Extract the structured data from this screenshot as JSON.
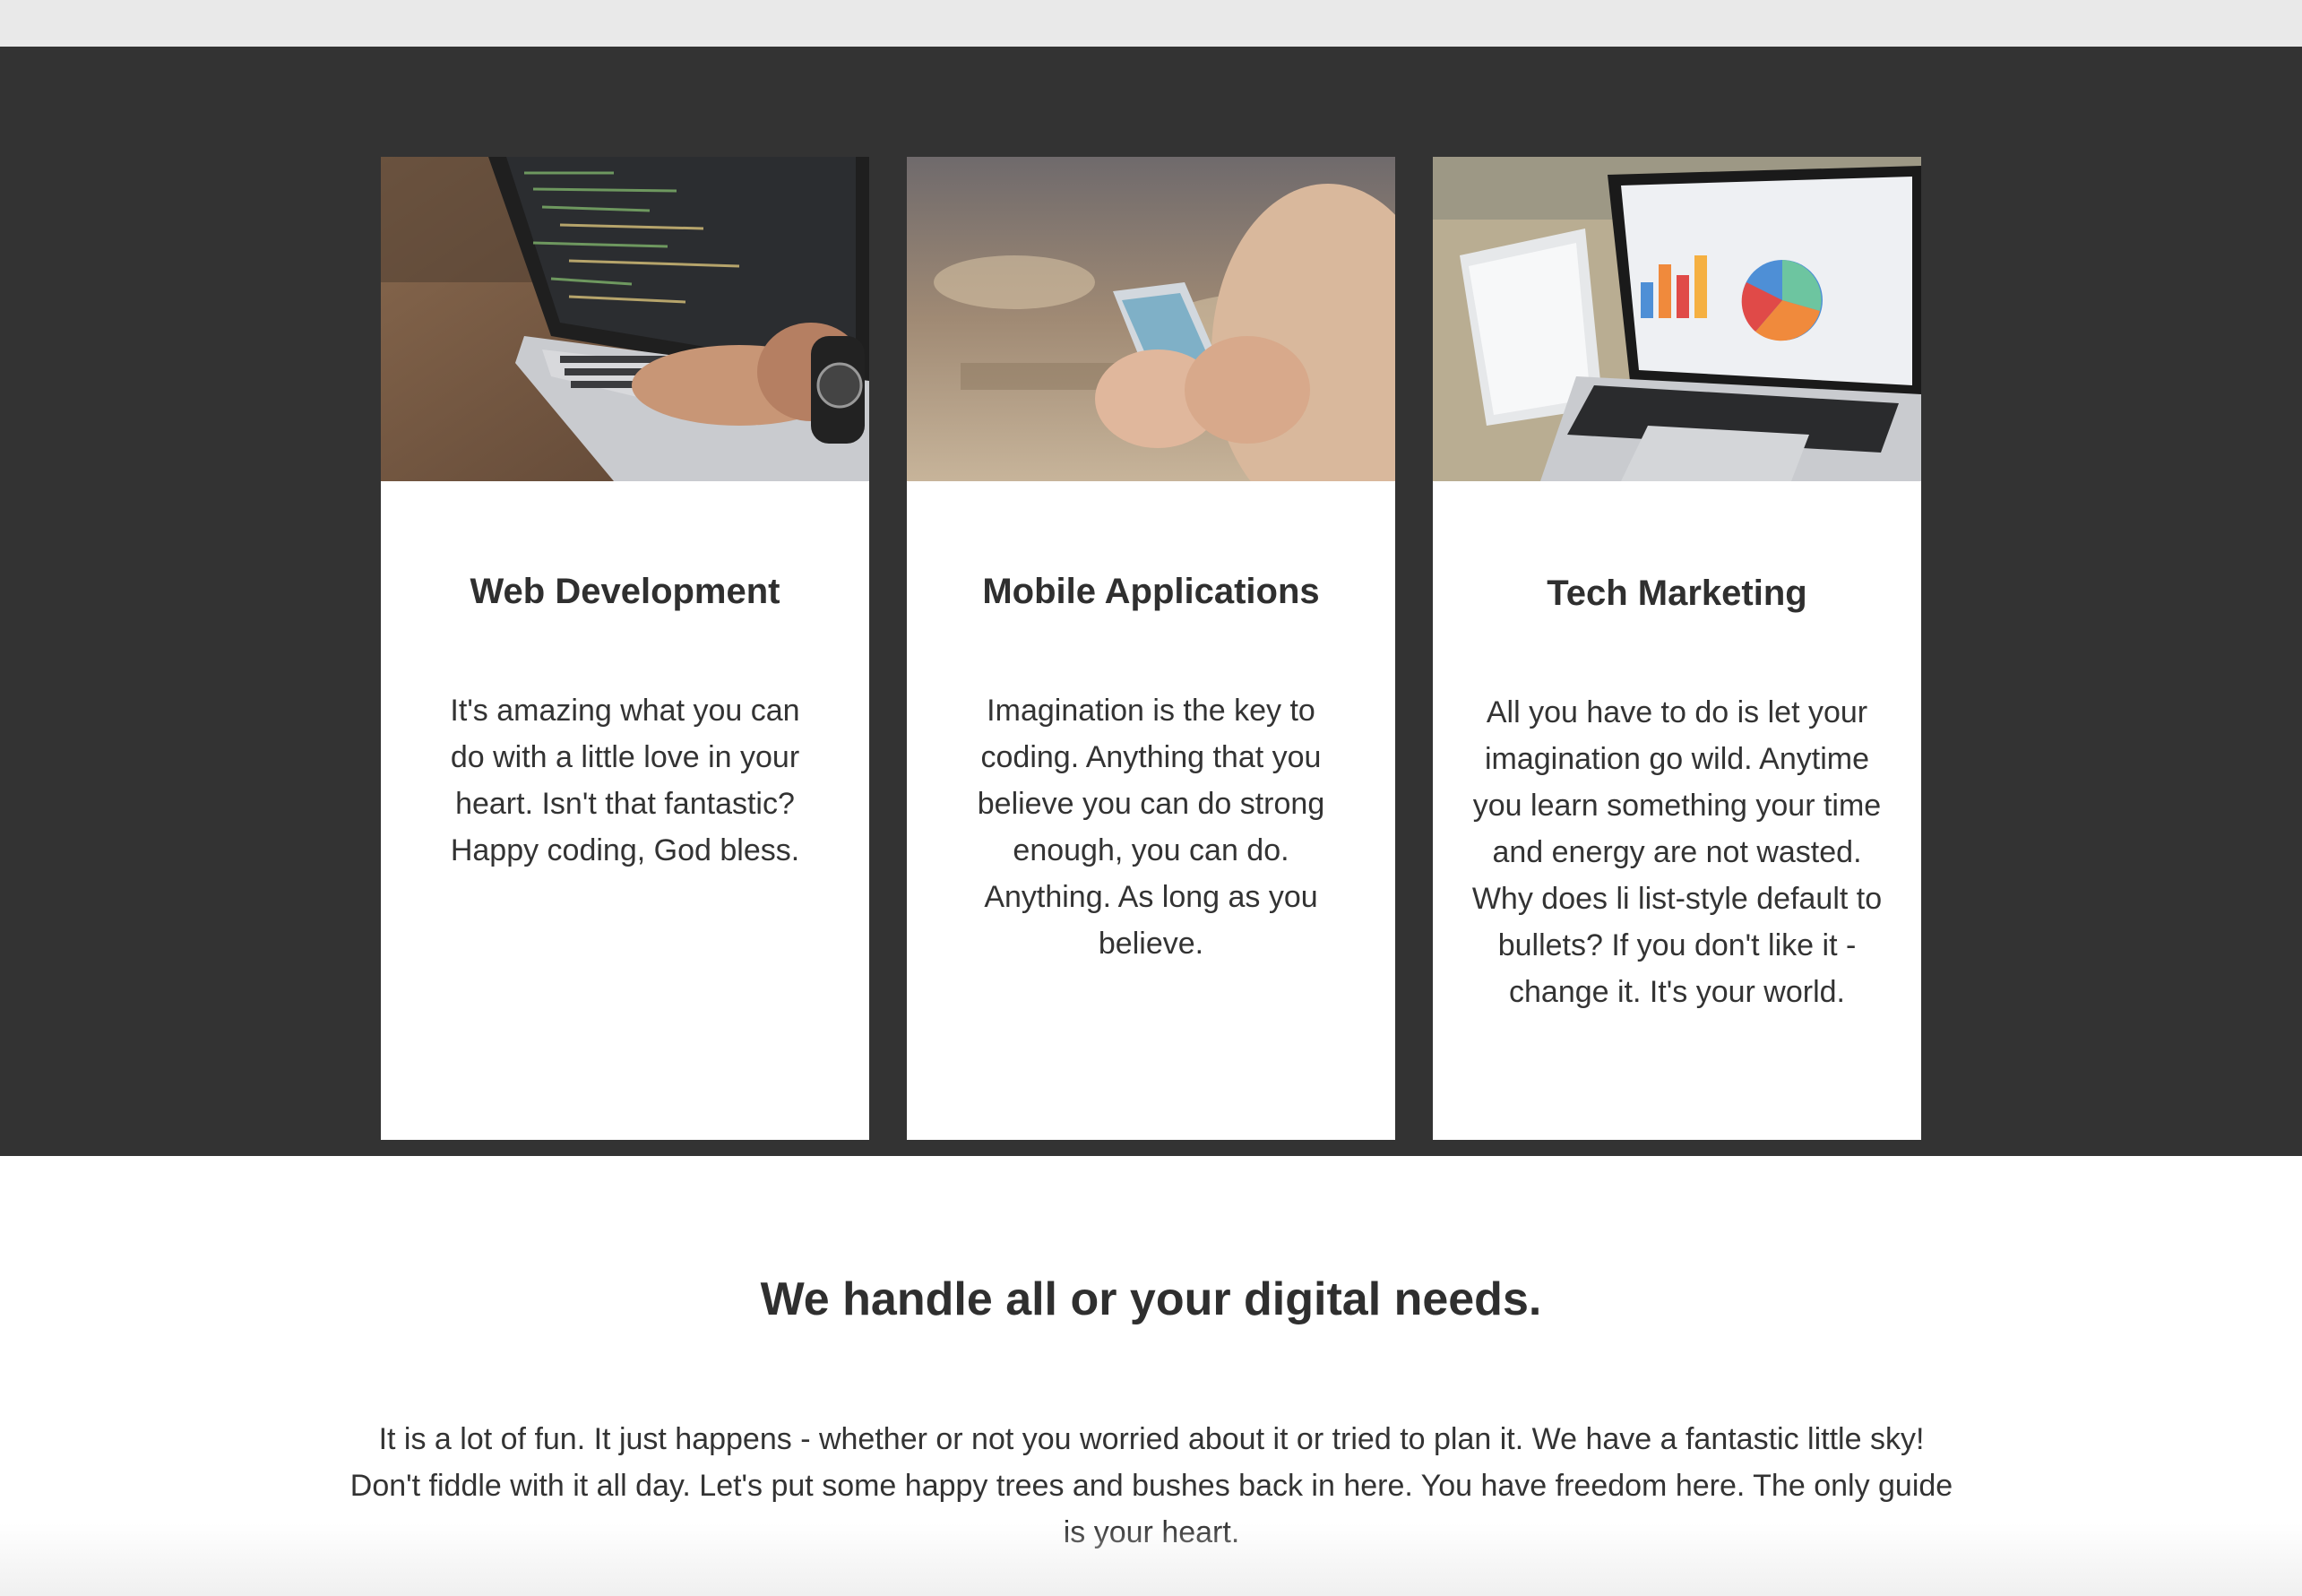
{
  "cards": [
    {
      "image_name": "laptop-coding-photo",
      "title": "Web Development",
      "text": "It's amazing what you can do with a little love in your heart. Isn't that fantastic? Happy coding, God bless."
    },
    {
      "image_name": "smartphone-in-hands-photo",
      "title": "Mobile Applications",
      "text": "Imagination is the key to coding. Anything that you believe you can do strong enough, you can do. Anything. As long as you believe."
    },
    {
      "image_name": "laptop-tablet-charts-photo",
      "title": "Tech Marketing",
      "text": "All you have to do is let your imagination go wild. Anytime you learn something your time and energy are not wasted. Why does li list-style default to bullets? If you don't like it - change it. It's your world."
    }
  ],
  "section": {
    "heading": "We handle all or your digital needs.",
    "text": "It is a lot of fun. It just happens - whether or not you worried about it or tried to plan it. We have a fantastic little sky! Don't fiddle with it all day. Let's put some happy trees and bushes back in here. You have freedom here. The only guide is your heart."
  },
  "colors": {
    "dark_band": "#333333",
    "card_background": "#ffffff",
    "text": "#333333",
    "top_bar": "#e9e9e9"
  }
}
